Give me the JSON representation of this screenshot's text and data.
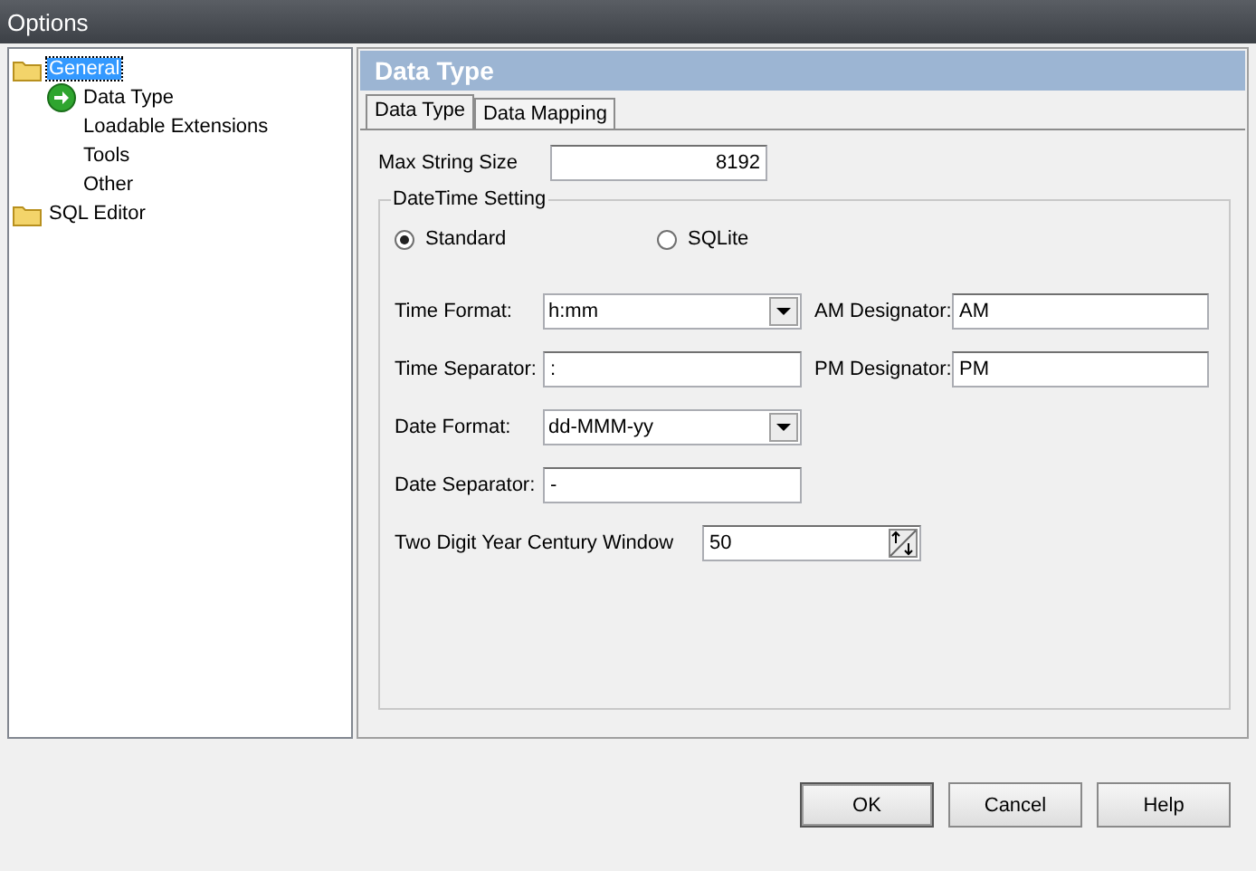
{
  "window": {
    "title": "Options"
  },
  "tree": [
    {
      "label": "General",
      "kind": "folder",
      "selected": true,
      "children": [
        {
          "label": "Data Type",
          "kind": "current",
          "selected": false
        },
        {
          "label": "Loadable Extensions",
          "kind": "plain",
          "selected": false
        },
        {
          "label": "Tools",
          "kind": "plain",
          "selected": false
        },
        {
          "label": "Other",
          "kind": "plain",
          "selected": false
        }
      ]
    },
    {
      "label": "SQL Editor",
      "kind": "folder",
      "selected": false
    }
  ],
  "panel": {
    "header": "Data Type",
    "tabs": [
      {
        "label": "Data Type",
        "selected": true
      },
      {
        "label": "Data Mapping",
        "selected": false
      }
    ],
    "max_string_size": {
      "label": "Max String Size",
      "value": "8192"
    },
    "group": {
      "title": "DateTime Setting",
      "radios": [
        {
          "label": "Standard",
          "selected": true
        },
        {
          "label": "SQLite",
          "selected": false
        }
      ],
      "rows": [
        {
          "left": {
            "kind": "dropdown",
            "label": "Time Format:",
            "value": "h:mm"
          },
          "right": {
            "kind": "text",
            "label": "AM Designator:",
            "value": "AM"
          }
        },
        {
          "left": {
            "kind": "text",
            "label": "Time Separator:",
            "value": ":"
          },
          "right": {
            "kind": "text",
            "label": "PM Designator:",
            "value": "PM"
          }
        },
        {
          "left": {
            "kind": "dropdown",
            "label": "Date Format:",
            "value": "dd-MMM-yy"
          }
        },
        {
          "left": {
            "kind": "text",
            "label": "Date Separator:",
            "value": "-"
          }
        }
      ],
      "century_window": {
        "label": "Two Digit Year Century Window",
        "value": "50"
      }
    }
  },
  "buttons": [
    {
      "label": "OK",
      "default": true
    },
    {
      "label": "Cancel",
      "default": false
    },
    {
      "label": "Help",
      "default": false
    }
  ]
}
